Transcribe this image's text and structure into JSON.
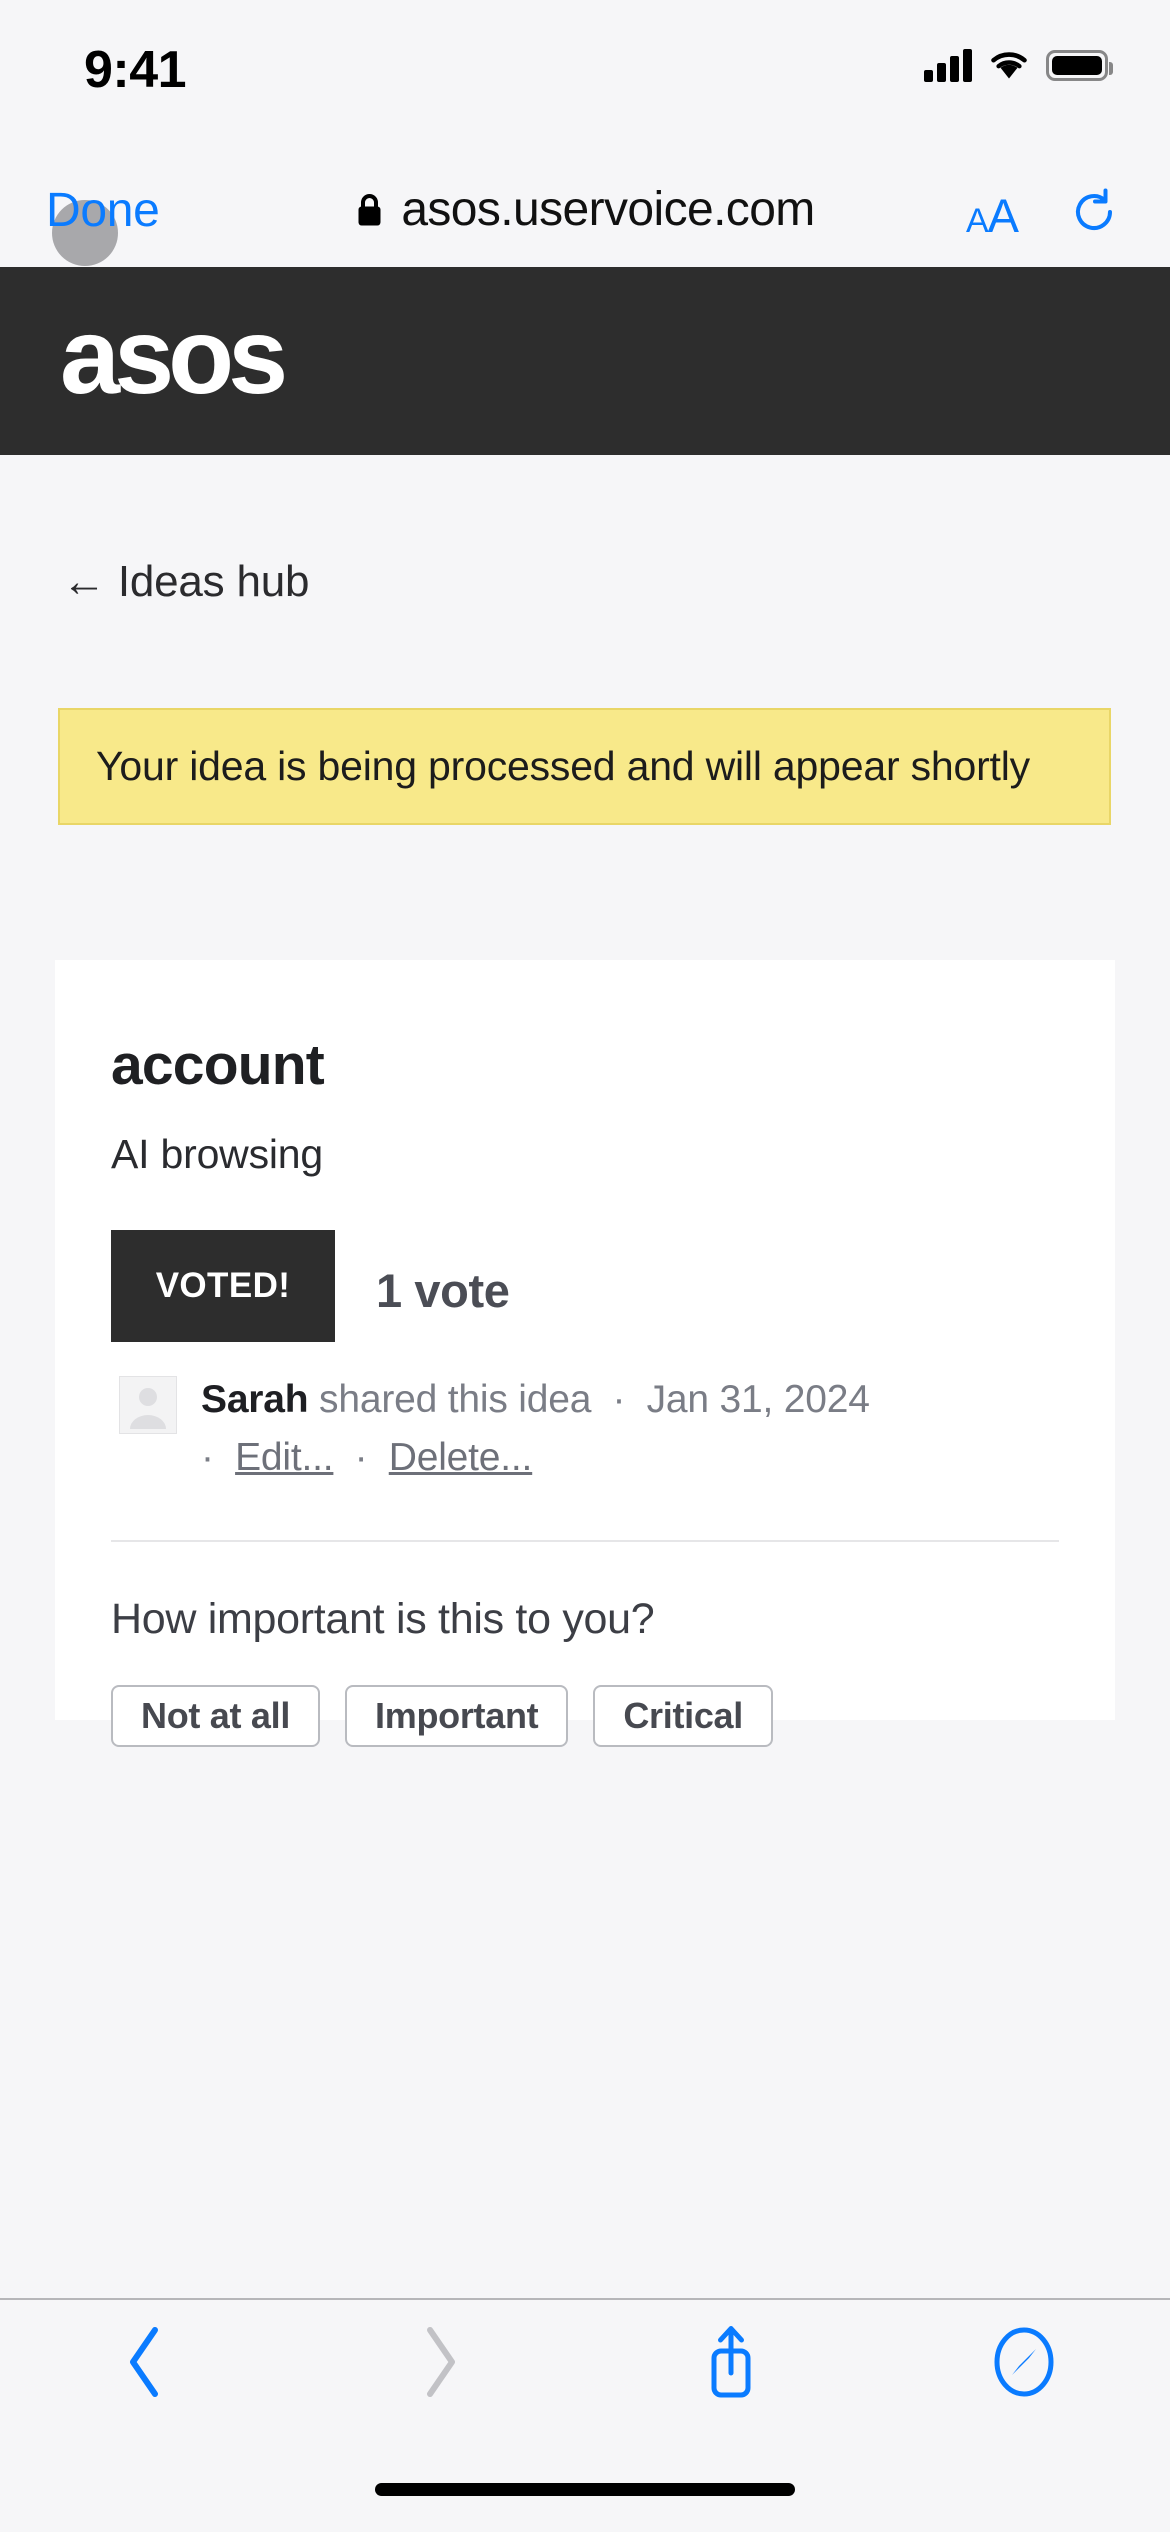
{
  "status_bar": {
    "time": "9:41",
    "cellular_icon": "cellular-signal-icon",
    "wifi_icon": "wifi-icon",
    "battery_icon": "battery-icon"
  },
  "browser_bar": {
    "done_label": "Done",
    "lock_icon": "lock-icon",
    "url": "asos.uservoice.com",
    "text_size_small": "A",
    "text_size_large": "A",
    "reload_icon": "reload-icon"
  },
  "site_header": {
    "logo_text": "asos",
    "logo_bg": "#2d2d2d"
  },
  "page": {
    "back_link": {
      "arrow": "←",
      "label": "Ideas hub"
    },
    "notice": {
      "text": "Your idea is being processed and will appear shortly",
      "bg": "#f8e98a",
      "border": "#e9d667"
    },
    "idea_card": {
      "title": "account",
      "description": "AI browsing",
      "vote_button_label": "VOTED!",
      "vote_button_bg": "#2d2d2d",
      "vote_count": "1 vote",
      "author": {
        "avatar_icon": "user-avatar-placeholder-icon",
        "name": "Sarah",
        "action_text": "shared this idea",
        "separator": "·",
        "date": "Jan 31, 2024",
        "edit_label": "Edit...",
        "delete_label": "Delete..."
      },
      "importance": {
        "question": "How important is this to you?",
        "options": [
          {
            "label": "Not at all"
          },
          {
            "label": "Important"
          },
          {
            "label": "Critical"
          }
        ]
      }
    }
  },
  "toolbar": {
    "back_icon": "chevron-left-icon",
    "forward_icon": "chevron-right-icon",
    "share_icon": "share-icon",
    "tabs_icon": "safari-compass-icon",
    "back_enabled_color": "#0a7bff",
    "forward_disabled_color": "#c2c2c6"
  }
}
